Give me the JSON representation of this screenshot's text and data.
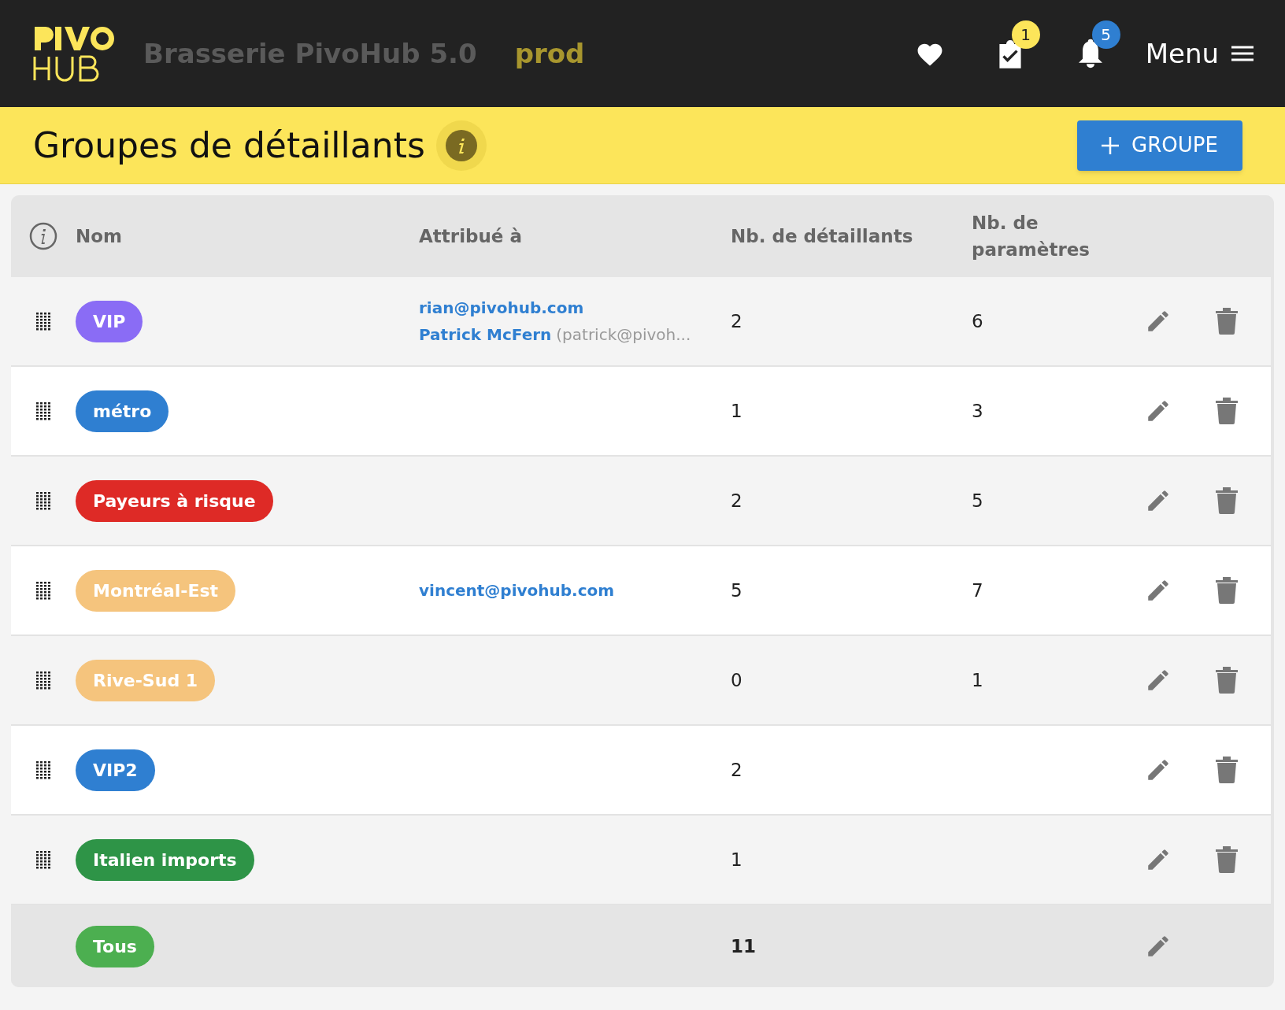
{
  "header": {
    "app_name": "Brasserie PivoHub 5.0",
    "environment": "prod",
    "tasks_badge": "1",
    "notifications_badge": "5",
    "menu_label": "Menu"
  },
  "page": {
    "title": "Groupes de détaillants",
    "add_button": "GROUPE"
  },
  "table": {
    "columns": [
      "Nom",
      "Attribué à",
      "Nb. de détaillants",
      "Nb. de paramètres"
    ],
    "rows": [
      {
        "kind": "group",
        "name": "VIP",
        "color": "#8a6cf5",
        "assigned": [
          {
            "link": "rian@pivohub.com"
          },
          {
            "link": "Patrick McFern",
            "note": "(patrick@pivoh..."
          }
        ],
        "retailers": "2",
        "parameters": "6"
      },
      {
        "kind": "group",
        "name": "métro",
        "color": "#2f7fd1",
        "retailers": "1",
        "parameters": "3"
      },
      {
        "kind": "group",
        "name": "Payeurs à risque",
        "color": "#de2a26",
        "retailers": "2",
        "parameters": "5"
      },
      {
        "kind": "group",
        "name": "Montréal-Est",
        "color": "#f5c47d",
        "assigned": [
          {
            "link": "vincent@pivohub.com"
          }
        ],
        "retailers": "5",
        "parameters": "7"
      },
      {
        "kind": "group",
        "name": "Rive-Sud 1",
        "color": "#f5c47d",
        "retailers": "0",
        "parameters": "1"
      },
      {
        "kind": "group",
        "name": "VIP2",
        "color": "#2f7fd1",
        "retailers": "2"
      },
      {
        "kind": "group",
        "name": "Italien imports",
        "color": "#2e9447",
        "retailers": "1"
      },
      {
        "kind": "total",
        "name": "Tous",
        "color": "#4caf50",
        "retailers": "11"
      }
    ]
  }
}
